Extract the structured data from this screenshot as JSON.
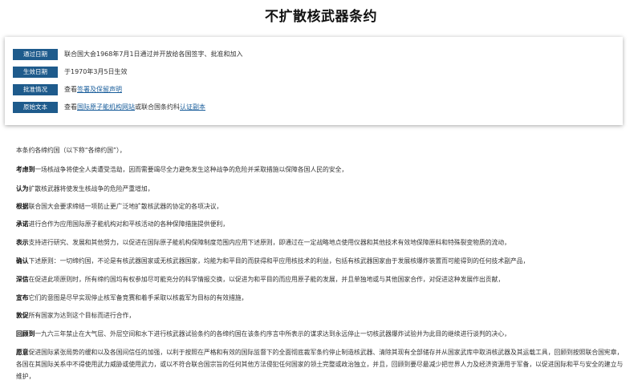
{
  "title": "不扩散核武器条约",
  "info": {
    "adopted": {
      "label": "通过日期",
      "value": "联合国大会1968年7月1日通过并开放给各国签字、批准和加入"
    },
    "effective": {
      "label": "生效日期",
      "value": "于1970年3月5日生效"
    },
    "ratification": {
      "label": "批准情况",
      "prefix": "查看",
      "link": "签署及保留声明"
    },
    "original": {
      "label": "原始文本",
      "prefix": "查看",
      "link1": "国际原子能机构网站",
      "mid": "或联合国条约科",
      "link2": "认证副本"
    }
  },
  "preamble": {
    "intro": "本条约各缔约国（以下称“各缔约国”），",
    "p1": {
      "lead": "考虑到",
      "text": "一场核战争将使全人类遭受浩劫，因而需要竭尽全力避免发生这种战争的危险并采取措施以保障各国人民的安全，"
    },
    "p2": {
      "lead": "认为",
      "text": "扩散核武器将使发生核战争的危险严重增加，"
    },
    "p3": {
      "lead": "根据",
      "text": "联合国大会要求缔结一项防止更广泛地扩散核武器的协定的各项决议，"
    },
    "p4": {
      "lead": "承诺",
      "text": "进行合作为应用国际原子能机构对和平核活动的各种保障措施提供便利，"
    },
    "p5": {
      "lead": "表示",
      "text": "支持进行研究、发展和其他努力，以促进在国际原子能机构保障制度范围内应用下述原则，即通过在一定战略地点使用仪器和其他技术有效地保障原料和特殊裂变物质的流动，"
    },
    "p6": {
      "lead": "确认",
      "text": "下述原则：一切缔约国，不论是有核武器国家或无核武器国家，均能为和平目的而获得和平应用核技术的利益，包括有核武器国家由于发展核爆炸装置而可能得到的任何技术副产品，"
    },
    "p7": {
      "lead": "深信",
      "text": "在促进此项原则时，所有缔约国均有权参加尽可能充分的科学情报交换，以促进为和平目的而应用原子能的发展，并且单独地或与其他国家合作，对促进这种发展作出贡献，"
    },
    "p8": {
      "lead": "宣布",
      "text": "它们的意图是尽早实现停止核军备竞赛和着手采取以核裁军为目标的有效措施，"
    },
    "p9": {
      "lead": "敦促",
      "text": "所有国家为达到这个目标而进行合作，"
    },
    "p10": {
      "lead": "回顾到",
      "text": "一九六三年禁止在大气层、外层空间和水下进行核武器试验条约的各缔约国在该条约序言中所表示的谋求达到永远停止一切核武器爆炸试验并为此目的继续进行谈判的决心，"
    },
    "p11": {
      "lead": "愿意",
      "text": "促进国际紧张局势的缓和以及各国间信任的加强，以利于按照在严格和有效的国际监督下的全面彻底裁军条约停止制造核武器、清除其现有全部储存并从国家武库中取消核武器及其运载工具，回顾到按照联合国宪章，各国在其国际关系中不得使用武力威胁或使用武力，或以不符合联合国宗旨的任何其他方法侵犯任何国家的领土完整或政治独立，并且，回顾到要尽最减少把世界人力及经济资源用于军备，以促进国际和平与安全的建立与维护，"
    }
  }
}
